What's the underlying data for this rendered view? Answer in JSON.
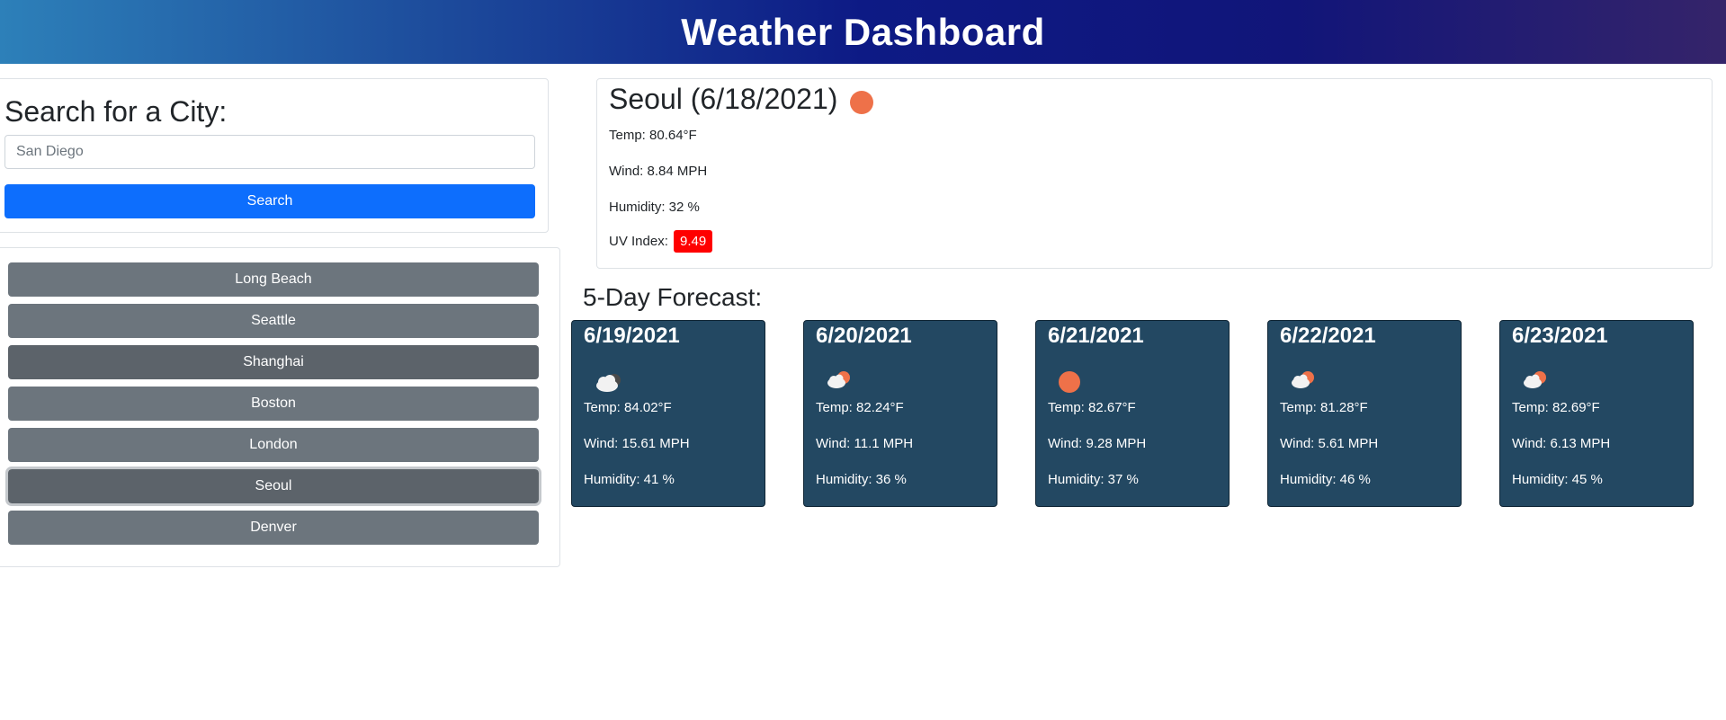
{
  "header": {
    "title": "Weather Dashboard"
  },
  "search": {
    "title": "Search for a City:",
    "placeholder": "San Diego",
    "button_label": "Search"
  },
  "history": {
    "items": [
      "Long Beach",
      "Seattle",
      "Shanghai",
      "Boston",
      "London",
      "Seoul",
      "Denver"
    ],
    "focused": "Seoul"
  },
  "current": {
    "title": "Seoul (6/18/2021)",
    "icon": "sun-icon",
    "temp": "Temp: 80.64°F",
    "wind": "Wind: 8.84 MPH",
    "humidity": "Humidity: 32 %",
    "uv_label": "UV Index:",
    "uv_value": "9.49"
  },
  "forecast": {
    "title": "5-Day Forecast:",
    "days": [
      {
        "date": "6/19/2021",
        "icon": "cloudy-night-icon",
        "temp": "Temp: 84.02°F",
        "wind": "Wind: 15.61 MPH",
        "humidity": "Humidity: 41 %"
      },
      {
        "date": "6/20/2021",
        "icon": "partly-cloudy-icon",
        "temp": "Temp: 82.24°F",
        "wind": "Wind: 11.1 MPH",
        "humidity": "Humidity: 36 %"
      },
      {
        "date": "6/21/2021",
        "icon": "sun-icon",
        "temp": "Temp: 82.67°F",
        "wind": "Wind: 9.28 MPH",
        "humidity": "Humidity: 37 %"
      },
      {
        "date": "6/22/2021",
        "icon": "partly-cloudy-icon",
        "temp": "Temp: 81.28°F",
        "wind": "Wind: 5.61 MPH",
        "humidity": "Humidity: 46 %"
      },
      {
        "date": "6/23/2021",
        "icon": "partly-cloudy-icon",
        "temp": "Temp: 82.69°F",
        "wind": "Wind: 6.13 MPH",
        "humidity": "Humidity: 45 %"
      }
    ]
  },
  "colors": {
    "primary": "#0d6efd",
    "secondary": "#6c757d",
    "card_bg": "#234862",
    "uv_high": "#ff0000",
    "sun": "#ee7149"
  }
}
